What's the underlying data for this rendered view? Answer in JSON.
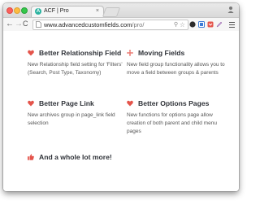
{
  "browser": {
    "tab_title": "ACF | Pro",
    "tab_favicon_letter": "A",
    "tab_close": "×",
    "url_host": "www.advancedcustomfields.com",
    "url_path": "/pro/",
    "nav_back": "←",
    "nav_forward": "→",
    "nav_reload": "C"
  },
  "features": [
    {
      "icon": "heart-icon",
      "title": "Better Relationship Field",
      "description": "New Relationship field setting for 'Filters' (Search, Post Type, Taxonomy)"
    },
    {
      "icon": "move-arrows-icon",
      "title": "Moving Fields",
      "description": "New field group functionality allows you to move a field between groups & parents"
    },
    {
      "icon": "heart-icon",
      "title": "Better Page Link",
      "description": "New archives group in page_link field selection"
    },
    {
      "icon": "heart-icon",
      "title": "Better Options Pages",
      "description": "New functions for options page allow creation of both parent and child menu pages"
    },
    {
      "icon": "thumbs-up-icon",
      "title": "And a whole lot more!"
    }
  ],
  "colors": {
    "accent": "#e4544b",
    "title_text": "#2f3238",
    "body_text": "#555555"
  }
}
